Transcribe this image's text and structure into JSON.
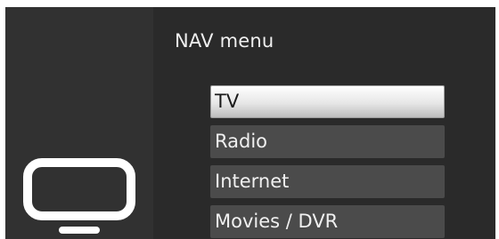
{
  "menu": {
    "title": "NAV menu",
    "items": [
      {
        "label": "TV",
        "selected": true
      },
      {
        "label": "Radio",
        "selected": false
      },
      {
        "label": "Internet",
        "selected": false
      },
      {
        "label": "Movies / DVR",
        "selected": false
      }
    ]
  },
  "side_panel": {
    "icon": "tv-icon"
  },
  "colors": {
    "background": "#2b2b2b",
    "side_panel": "#313131",
    "item": "#4b4b4b",
    "item_selected": "#e6e6e6",
    "text": "#f0f0f0",
    "text_selected": "#1a1a1a"
  }
}
